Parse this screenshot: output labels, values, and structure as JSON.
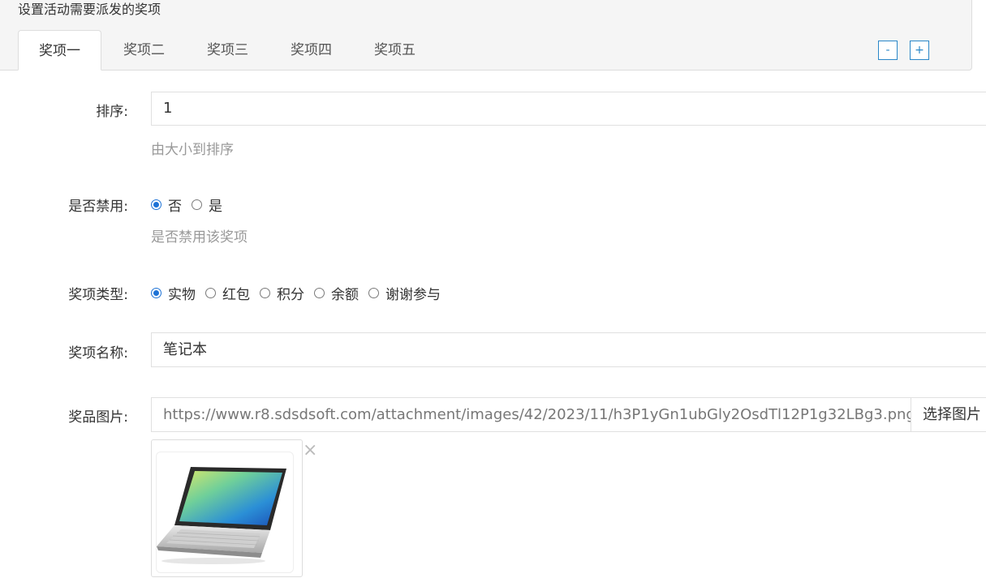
{
  "header": {
    "title": "设置活动需要派发的奖项",
    "tabs": [
      {
        "label": "奖项一",
        "active": true
      },
      {
        "label": "奖项二"
      },
      {
        "label": "奖项三"
      },
      {
        "label": "奖项四"
      },
      {
        "label": "奖项五"
      }
    ],
    "minus_label": "-",
    "plus_label": "+"
  },
  "form": {
    "sort": {
      "label": "排序:",
      "value": "1",
      "help": "由大小到排序"
    },
    "disabled": {
      "label": "是否禁用:",
      "options": [
        {
          "label": "否",
          "checked": true
        },
        {
          "label": "是"
        }
      ],
      "help": "是否禁用该奖项"
    },
    "type": {
      "label": "奖项类型:",
      "options": [
        {
          "label": "实物",
          "checked": true
        },
        {
          "label": "红包"
        },
        {
          "label": "积分"
        },
        {
          "label": "余额"
        },
        {
          "label": "谢谢参与"
        }
      ]
    },
    "name": {
      "label": "奖项名称:",
      "value": "笔记本"
    },
    "image": {
      "label": "奖品图片:",
      "url": "https://www.r8.sdsdsoft.com/attachment/images/42/2023/11/h3P1yGn1ubGly2OsdTl12P1g32LBg3.png",
      "pick_label": "选择图片",
      "remove_label": "×",
      "icon": "laptop-image"
    }
  },
  "colors": {
    "accent": "#1e73d6",
    "tab_button": "#2a87c8"
  }
}
